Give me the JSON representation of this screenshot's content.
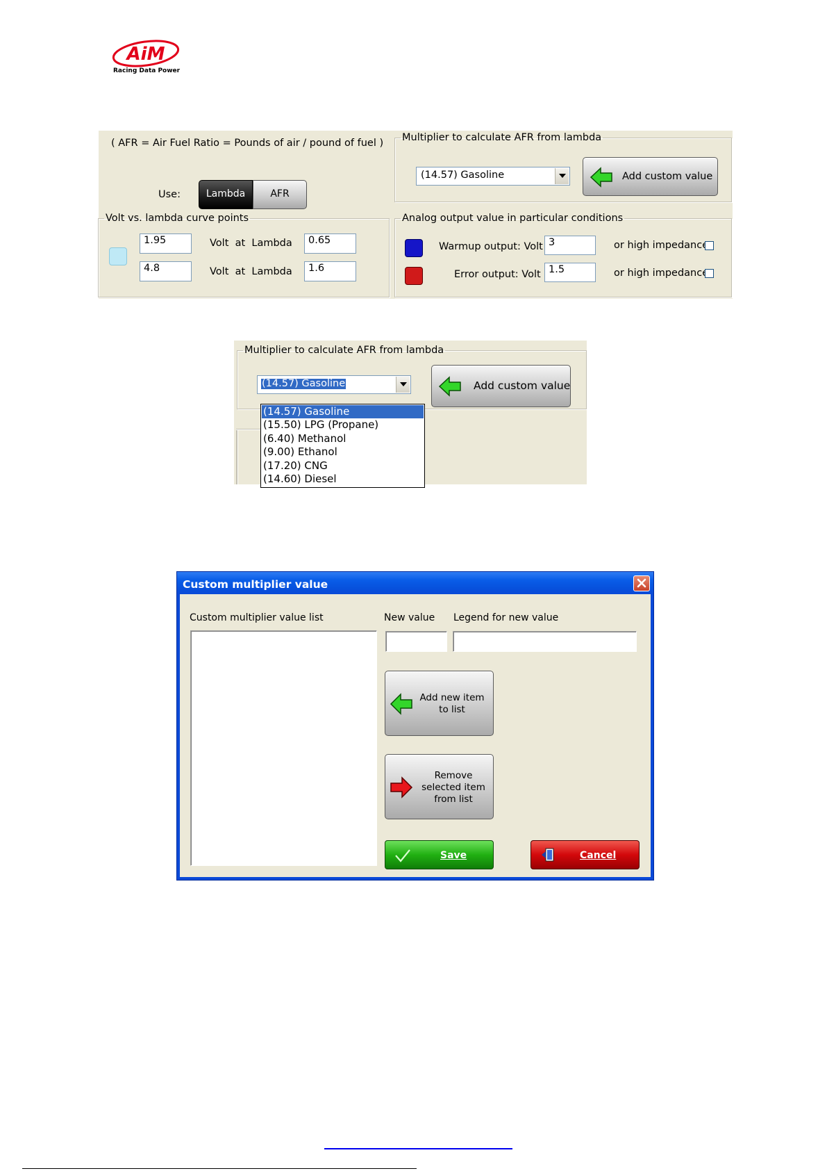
{
  "logo": {
    "text": "AiM",
    "tagline": "Racing Data Power"
  },
  "panel1": {
    "afr_note": "( AFR = Air Fuel Ratio = Pounds of air / pound of fuel )",
    "use_label": "Use:",
    "toggle": [
      {
        "label": "Lambda",
        "selected": true
      },
      {
        "label": "AFR",
        "selected": false
      }
    ],
    "multiplier": {
      "legend": "Multiplier to calculate AFR from lambda",
      "selected": "(14.57) Gasoline",
      "add_button": "Add custom value"
    },
    "curve": {
      "legend": "Volt vs. lambda curve points",
      "mid_label": "Volt  at  Lambda",
      "rows": [
        {
          "volt": "1.95",
          "lambda": "0.65"
        },
        {
          "volt": "4.8",
          "lambda": "1.6"
        }
      ]
    },
    "analog": {
      "legend": "Analog output value in particular conditions",
      "warmup_label": "Warmup output: Volt",
      "warmup_value": "3",
      "error_label": "Error output: Volt",
      "error_value": "1.5",
      "impedance_label": "or high impedance"
    },
    "colors": {
      "warmup": "#1515c8",
      "error": "#d01a1a",
      "curve_swatch": "#bfe9f6"
    }
  },
  "panel2": {
    "legend": "Multiplier to calculate AFR from lambda",
    "selected": "(14.57) Gasoline",
    "add_button": "Add custom value",
    "options": [
      "(14.57) Gasoline",
      "(15.50) LPG (Propane)",
      "(6.40) Methanol",
      "(9.00) Ethanol",
      "(17.20) CNG",
      "(14.60) Diesel"
    ],
    "highlighted_index": 0
  },
  "dialog": {
    "title": "Custom multiplier value",
    "list_label": "Custom multiplier value list",
    "new_value_label": "New value",
    "legend_label": "Legend for new value",
    "new_value": "",
    "legend_value": "",
    "add_button": "Add new item to list",
    "remove_button": "Remove selected item from list",
    "save_button": "Save",
    "cancel_button": "Cancel"
  }
}
